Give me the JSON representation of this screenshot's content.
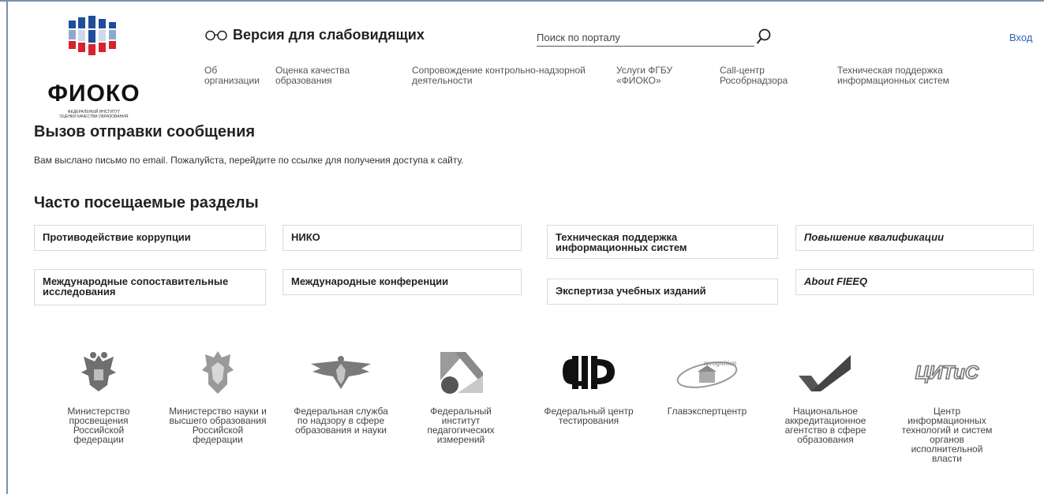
{
  "header": {
    "logo_text": "ФИОКО",
    "logo_subtitle_line1": "ФЕДЕРАЛЬНЫЙ ИНСТИТУТ",
    "logo_subtitle_line2": "ОЦЕНКИ КАЧЕСТВА ОБРАЗОВАНИЯ",
    "low_vision_label": "Версия для слабовидящих",
    "search_placeholder": "Поиск по порталу",
    "login_label": "Вход",
    "nav": [
      {
        "line1": "Об",
        "line2": "организации"
      },
      {
        "line1": "Оценка качества",
        "line2": "образования"
      },
      {
        "line1": "Сопровождение контрольно-надзорной",
        "line2": "деятельности"
      },
      {
        "line1": "Услуги ФГБУ",
        "line2": "«ФИОКО»"
      },
      {
        "line1": "Call-центр",
        "line2": "Рособрнадзора"
      },
      {
        "line1": "Техническая поддержка",
        "line2": "информационных систем"
      }
    ]
  },
  "main": {
    "title": "Вызов отправки сообщения",
    "message": "Вам выслано письмо по email. Пожалуйста, перейдите по ссылке для получения доступа к сайту.",
    "sections_title": "Часто посещаемые разделы",
    "sections": [
      {
        "line1": "Противодействие коррупции",
        "line2": ""
      },
      {
        "line1": "НИКО",
        "line2": ""
      },
      {
        "line1": "Техническая поддержка",
        "line2": "информационных систем"
      },
      {
        "line1": "Повышение квалификации",
        "line2": ""
      },
      {
        "line1": "Международные сопоставительные",
        "line2": "исследования"
      },
      {
        "line1": "Международные конференции",
        "line2": ""
      },
      {
        "line1": "Экспертиза учебных изданий",
        "line2": ""
      },
      {
        "line1": "About FIEEQ",
        "line2": ""
      }
    ]
  },
  "partners": [
    {
      "icon": "eagle-emblem-icon",
      "lines": [
        "Министерство",
        "просвещения",
        "Российской",
        "федерации"
      ]
    },
    {
      "icon": "eagle-crest-icon",
      "lines": [
        "Министерство науки и",
        "высшего образования",
        "Российской",
        "федерации"
      ]
    },
    {
      "icon": "winged-emblem-icon",
      "lines": [
        "Федеральная служба",
        "по надзору в сфере",
        "образования и науки"
      ]
    },
    {
      "icon": "fip-logo-icon",
      "lines": [
        "Федеральный",
        "институт",
        "педагогических",
        "измерений"
      ]
    },
    {
      "icon": "ftc-logo-icon",
      "lines": [
        "Федеральный центр",
        "тестирования"
      ]
    },
    {
      "icon": "recognition-logo-icon",
      "logo_text": "recognition",
      "lines": [
        "Главэкспертцентр"
      ]
    },
    {
      "icon": "checkmark-logo-icon",
      "lines": [
        "Национальное",
        "аккредитационное",
        "агентство в сфере",
        "образования"
      ]
    },
    {
      "icon": "citis-logo-icon",
      "logo_text": "ЦИТиС",
      "lines": [
        "Центр",
        "информационных",
        "технологий и систем",
        "органов",
        "исполнительной",
        "власти"
      ]
    }
  ],
  "colors": {
    "link": "#2a66b5",
    "logo_blue": "#1f4e9a",
    "logo_red": "#d8232a",
    "partner_gray": "#555555"
  }
}
